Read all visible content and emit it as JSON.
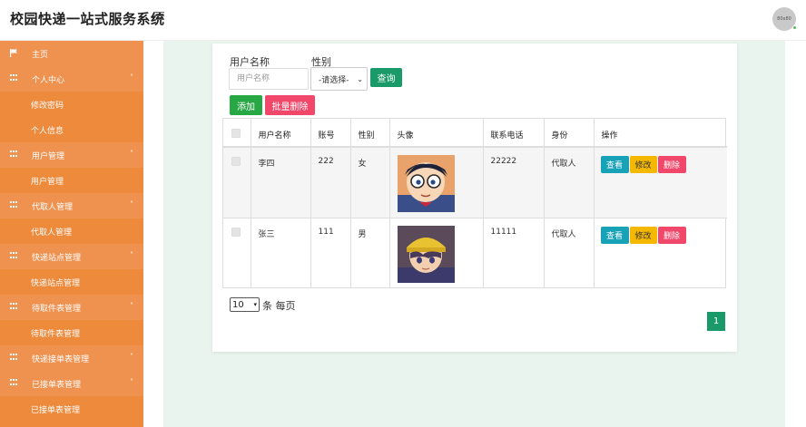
{
  "header": {
    "title": "校园快递一站式服务系统",
    "avatar_text": "80x80"
  },
  "sidebar": {
    "items": [
      {
        "label": "主页",
        "type": "group",
        "icon": "flag-icon"
      },
      {
        "label": "个人中心",
        "type": "group",
        "icon": "grid-icon",
        "expanded": true
      },
      {
        "label": "修改密码",
        "type": "sub"
      },
      {
        "label": "个人信息",
        "type": "sub"
      },
      {
        "label": "用户管理",
        "type": "group",
        "icon": "grid-icon",
        "expanded": true
      },
      {
        "label": "用户管理",
        "type": "sub"
      },
      {
        "label": "代取人管理",
        "type": "group",
        "icon": "grid-icon",
        "expanded": true
      },
      {
        "label": "代取人管理",
        "type": "sub"
      },
      {
        "label": "快递站点管理",
        "type": "group",
        "icon": "grid-icon",
        "expanded": true
      },
      {
        "label": "快递站点管理",
        "type": "sub"
      },
      {
        "label": "待取件表管理",
        "type": "group",
        "icon": "grid-icon",
        "expanded": true
      },
      {
        "label": "待取件表管理",
        "type": "sub"
      },
      {
        "label": "快递接单表管理",
        "type": "group",
        "icon": "grid-icon",
        "expanded": false
      },
      {
        "label": "已接单表管理",
        "type": "group",
        "icon": "grid-icon",
        "expanded": true
      },
      {
        "label": "已接单表管理",
        "type": "sub"
      }
    ]
  },
  "search": {
    "username_label": "用户名称",
    "username_placeholder": "用户名称",
    "gender_label": "性别",
    "gender_selected": "-请选择-",
    "query_label": "查询"
  },
  "toolbar": {
    "add_label": "添加",
    "batch_delete_label": "批量删除"
  },
  "table": {
    "columns": [
      "",
      "用户名称",
      "账号",
      "性别",
      "头像",
      "联系电话",
      "身份",
      "操作"
    ],
    "rows": [
      {
        "name": "李四",
        "account": "222",
        "gender": "女",
        "avatar": "boy-with-glasses",
        "phone": "22222",
        "role": "代取人"
      },
      {
        "name": "张三",
        "account": "111",
        "gender": "男",
        "avatar": "boy-with-yellow-hat",
        "phone": "11111",
        "role": "代取人"
      }
    ],
    "actions": {
      "view": "查看",
      "edit": "修改",
      "delete": "删除"
    }
  },
  "pagination": {
    "page_size": "10",
    "per_page_text": "条 每页",
    "current_page": "1"
  },
  "colors": {
    "sidebar": "#ee8a3c",
    "accent": "#1a9a68",
    "danger": "#f0476a",
    "warning": "#f5b800",
    "info": "#17a2b8"
  }
}
